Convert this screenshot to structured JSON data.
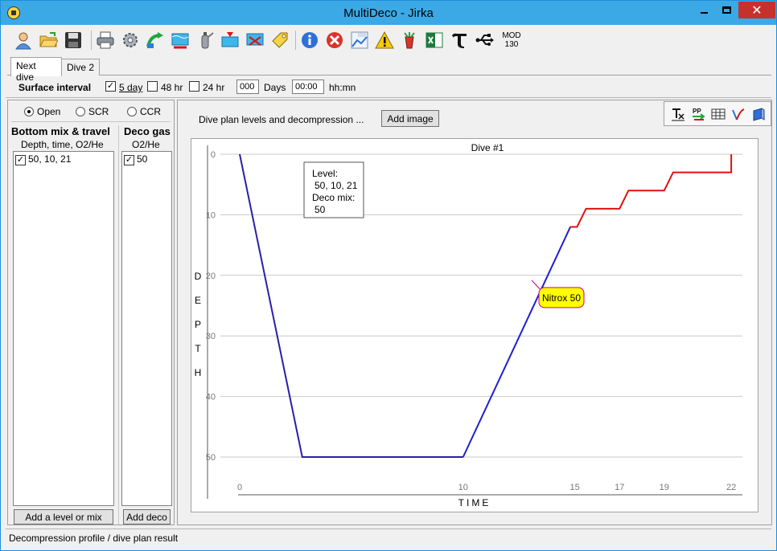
{
  "window": {
    "title": "MultiDeco - Jirka",
    "close_glyph": "✕"
  },
  "toolbar": {
    "mod_label": "MOD",
    "mod_value": "130",
    "icons": [
      "user-icon",
      "open-folder-icon",
      "save-icon",
      "print-icon",
      "settings-gear-icon",
      "add-dive-icon",
      "water-icon",
      "tank-icon",
      "surface-icon",
      "dive-table-icon",
      "tag-icon",
      "info-icon",
      "stop-icon",
      "air-chart-icon",
      "warning-icon",
      "mix-icon",
      "excel-icon",
      "tau-icon",
      "usb-icon"
    ]
  },
  "tabs": [
    {
      "label": "Next dive",
      "active": true
    },
    {
      "label": "Dive 2",
      "active": false
    }
  ],
  "surface": {
    "label": "Surface interval",
    "options": [
      {
        "label": "5 day",
        "checked": true
      },
      {
        "label": "48 hr",
        "checked": false
      },
      {
        "label": "24 hr",
        "checked": false
      }
    ],
    "days_value": "000",
    "days_label": "Days",
    "time_value": "00:00",
    "time_label": "hh:mn"
  },
  "circuit": {
    "options": [
      {
        "label": "Open",
        "selected": true
      },
      {
        "label": "SCR",
        "selected": false
      },
      {
        "label": "CCR",
        "selected": false
      }
    ]
  },
  "bottom_mix": {
    "header": "Bottom mix & travel",
    "subheader": "Depth, time, O2/He",
    "items": [
      {
        "label": "50, 10, 21",
        "checked": true
      }
    ],
    "add_button": "Add a level or mix"
  },
  "deco_gas": {
    "header": "Deco gas",
    "subheader": "O2/He",
    "items": [
      {
        "label": "50",
        "checked": true
      }
    ],
    "add_button": "Add deco"
  },
  "plan": {
    "label": "Dive plan levels and decompression ...",
    "add_image_button": "Add image"
  },
  "mini_toolbar": {
    "icons": [
      "text-export-icon",
      "pp-graph-icon",
      "table-icon",
      "curve-icon",
      "export-icon"
    ]
  },
  "chart_data": {
    "type": "line",
    "title": "Dive #1",
    "xlabel": "TIME",
    "ylabel": "DEPTH",
    "x_ticks": [
      0,
      10,
      15,
      17,
      19,
      22
    ],
    "y_ticks": [
      0,
      10,
      20,
      30,
      40,
      50
    ],
    "xlim": [
      0,
      22.5
    ],
    "ylim": [
      0,
      50
    ],
    "y_inverted": true,
    "grid": true,
    "series": [
      {
        "color": "#2a1fa8",
        "points": [
          [
            0,
            0
          ],
          [
            2.8,
            50
          ],
          [
            10,
            50
          ],
          [
            14.8,
            12
          ]
        ]
      },
      {
        "color": "#e01010",
        "points": [
          [
            14.8,
            12
          ],
          [
            15.1,
            12
          ],
          [
            15.5,
            9
          ],
          [
            17,
            9
          ],
          [
            17.4,
            6
          ],
          [
            19,
            6
          ],
          [
            19.4,
            3
          ],
          [
            22,
            3
          ],
          [
            22,
            0
          ]
        ]
      }
    ],
    "tooltip": {
      "lines": [
        "Level:",
        "50, 10, 21",
        "Deco mix:",
        "50"
      ]
    },
    "callout": {
      "label": "Nitrox 50",
      "fill": "#ffff00"
    }
  },
  "status": {
    "text": "Decompression profile / dive plan result"
  },
  "colors": {
    "titlebar": "#3ba9e6",
    "close_button": "#c7312b",
    "ascent_line": "#1f1fd0",
    "deco_line": "#e01010"
  }
}
